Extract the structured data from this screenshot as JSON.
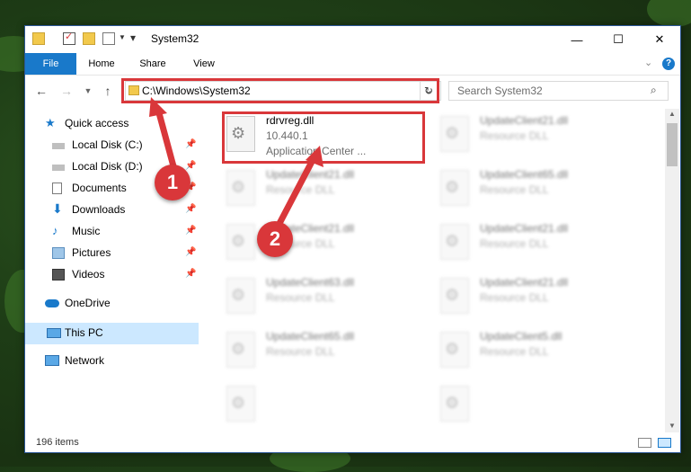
{
  "window": {
    "title": "System32",
    "controls": {
      "minimize": "—",
      "maximize": "☐",
      "close": "✕"
    }
  },
  "ribbon": {
    "tabs": [
      "File",
      "Home",
      "Share",
      "View"
    ]
  },
  "address": {
    "path": "C:\\Windows\\System32",
    "search_placeholder": "Search System32"
  },
  "nav": {
    "items": [
      {
        "label": "Quick access",
        "icon": "star-icon"
      },
      {
        "label": "Local Disk (C:)",
        "icon": "drive-icon",
        "pinned": true
      },
      {
        "label": "Local Disk (D:)",
        "icon": "drive-icon",
        "pinned": true
      },
      {
        "label": "Documents",
        "icon": "documents-icon",
        "pinned": true
      },
      {
        "label": "Downloads",
        "icon": "download-icon",
        "pinned": true
      },
      {
        "label": "Music",
        "icon": "music-icon",
        "pinned": true
      },
      {
        "label": "Pictures",
        "icon": "pictures-icon",
        "pinned": true
      },
      {
        "label": "Videos",
        "icon": "videos-icon",
        "pinned": true
      },
      {
        "label": "OneDrive",
        "icon": "cloud-icon"
      },
      {
        "label": "This PC",
        "icon": "computer-icon",
        "selected": true
      },
      {
        "label": "Network",
        "icon": "network-icon"
      }
    ]
  },
  "files": [
    {
      "name": "rdrvreg.dll",
      "line2": "10.440.1",
      "line3": "Application Center ...",
      "highlighted": true
    },
    {
      "name": "UpdateClient21.dll",
      "line2": "Resource DLL"
    },
    {
      "name": "UpdateClient65.dll",
      "line2": "Resource DLL"
    },
    {
      "name": "UpdateClient21.dll",
      "line2": "Resource DLL"
    },
    {
      "name": "UpdateClient21.dll",
      "line2": "Resource DLL"
    },
    {
      "name": "UpdateClient21.dll",
      "line2": "Resource DLL"
    },
    {
      "name": "UpdateClient63.dll",
      "line2": "Resource DLL"
    },
    {
      "name": "UpdateClient21.dll",
      "line2": "Resource DLL"
    },
    {
      "name": "UpdateClient65.dll",
      "line2": "Resource DLL"
    },
    {
      "name": "UpdateClient5.dll",
      "line2": "Resource DLL"
    }
  ],
  "status": {
    "item_count": "196 items"
  },
  "callouts": {
    "one": "1",
    "two": "2"
  },
  "colors": {
    "accent": "#1979ca",
    "highlight": "#d9373a",
    "selection": "#cce8ff"
  }
}
